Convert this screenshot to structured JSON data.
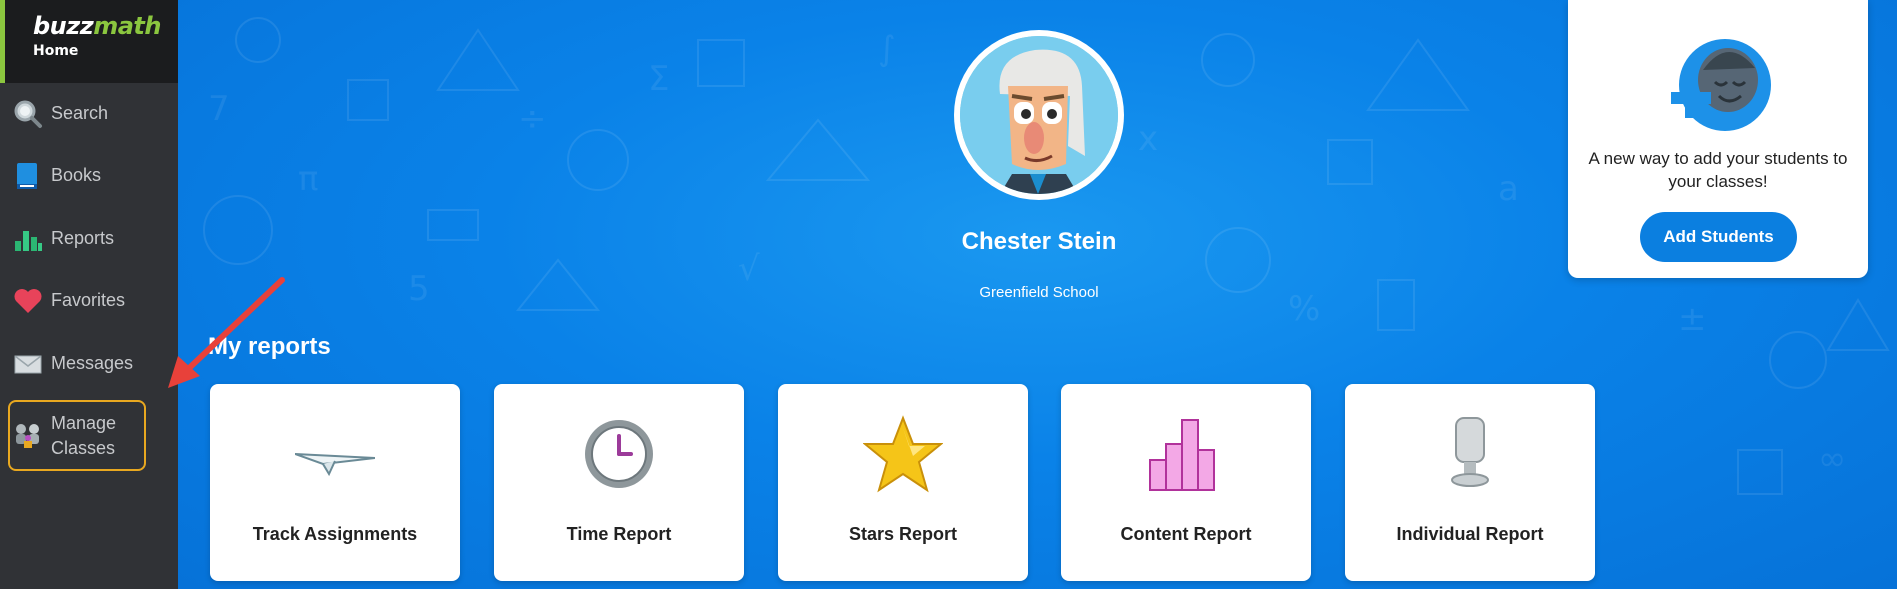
{
  "brand": {
    "logo_part1": "buzz",
    "logo_part2": "math",
    "subtitle": "Home"
  },
  "sidebar": {
    "items": [
      {
        "label": "Search",
        "icon": "search-icon"
      },
      {
        "label": "Books",
        "icon": "book-icon"
      },
      {
        "label": "Reports",
        "icon": "bar-chart-icon"
      },
      {
        "label": "Favorites",
        "icon": "heart-icon"
      },
      {
        "label": "Messages",
        "icon": "envelope-icon"
      },
      {
        "label_line1": "Manage",
        "label_line2": "Classes",
        "icon": "classes-icon",
        "highlighted": true
      }
    ]
  },
  "profile": {
    "name": "Chester Stein",
    "school": "Greenfield School"
  },
  "reports": {
    "title": "My reports",
    "cards": [
      {
        "label": "Track Assignments",
        "icon": "paper-plane-icon"
      },
      {
        "label": "Time Report",
        "icon": "clock-icon"
      },
      {
        "label": "Stars Report",
        "icon": "star-icon"
      },
      {
        "label": "Content Report",
        "icon": "bar-chart-icon"
      },
      {
        "label": "Individual Report",
        "icon": "trophy-icon"
      }
    ]
  },
  "promo": {
    "text": "A new way to add your students to your classes!",
    "button_label": "Add Students"
  },
  "colors": {
    "accent": "#8bc63f",
    "primary": "#0b7fe0",
    "highlight": "#e8a820",
    "arrow": "#e8413a"
  }
}
